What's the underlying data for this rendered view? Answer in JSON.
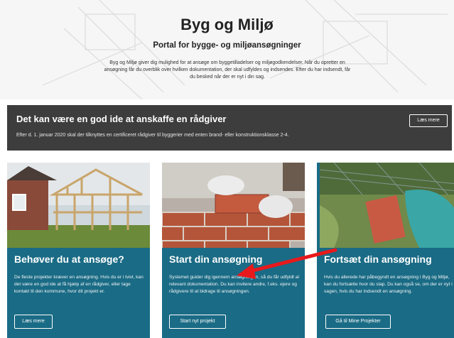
{
  "hero": {
    "title": "Byg og Miljø",
    "subtitle": "Portal for bygge- og miljøansøgninger",
    "intro": "Byg og Miljø giver dig mulighed for at ansøge om byggetilladelser og miljøgodkendelser. Når du opretter en ansøgning får du overblik over hvilken dokumentation, der skal udfyldes og indsendes. Efter du har indsendt, får du besked når der er nyt i din sag."
  },
  "banner": {
    "title": "Det kan være en god ide at anskaffe en rådgiver",
    "text": "Efter d. 1. januar 2020 skal der tilknyttes en certificeret rådgiver til byggerier med enten brand- eller konstruktionsklasse 2-4.",
    "button": "Læs mere"
  },
  "cards": [
    {
      "title": "Behøver du at ansøge?",
      "text": "De fleste projekter kræver en ansøgning. Hvis du er i tvivl, kan det være en god ide at få hjælp af en rådgiver, eller tage kontakt til den kommune, hvor dit projekt er.",
      "button": "Læs mere",
      "image": "house-under-construction"
    },
    {
      "title": "Start din ansøgning",
      "text": "Systemet guider dig igennem ansøgningen, så du får udfyldt al relevant dokumentation. Du kan invitere andre, f.eks. ejere og rådgivere til at bidrage til ansøgningen.",
      "button": "Start nyt projekt",
      "image": "bricklaying"
    },
    {
      "title": "Fortsæt din ansøgning",
      "text": "Hvis du allerede har påbegyndt en ansøgning i Byg og Miljø, kan du fortsætte hvor du slap. Du kan også se, om der er nyt i sagen, hvis du har indsendt en ansøgning.",
      "button": "Gå til Mine Projekter",
      "image": "aerial-farm"
    }
  ],
  "colors": {
    "card_bg": "#1a6b85",
    "banner_bg": "#3d3d3d",
    "annotation_arrow": "#e8191c"
  }
}
